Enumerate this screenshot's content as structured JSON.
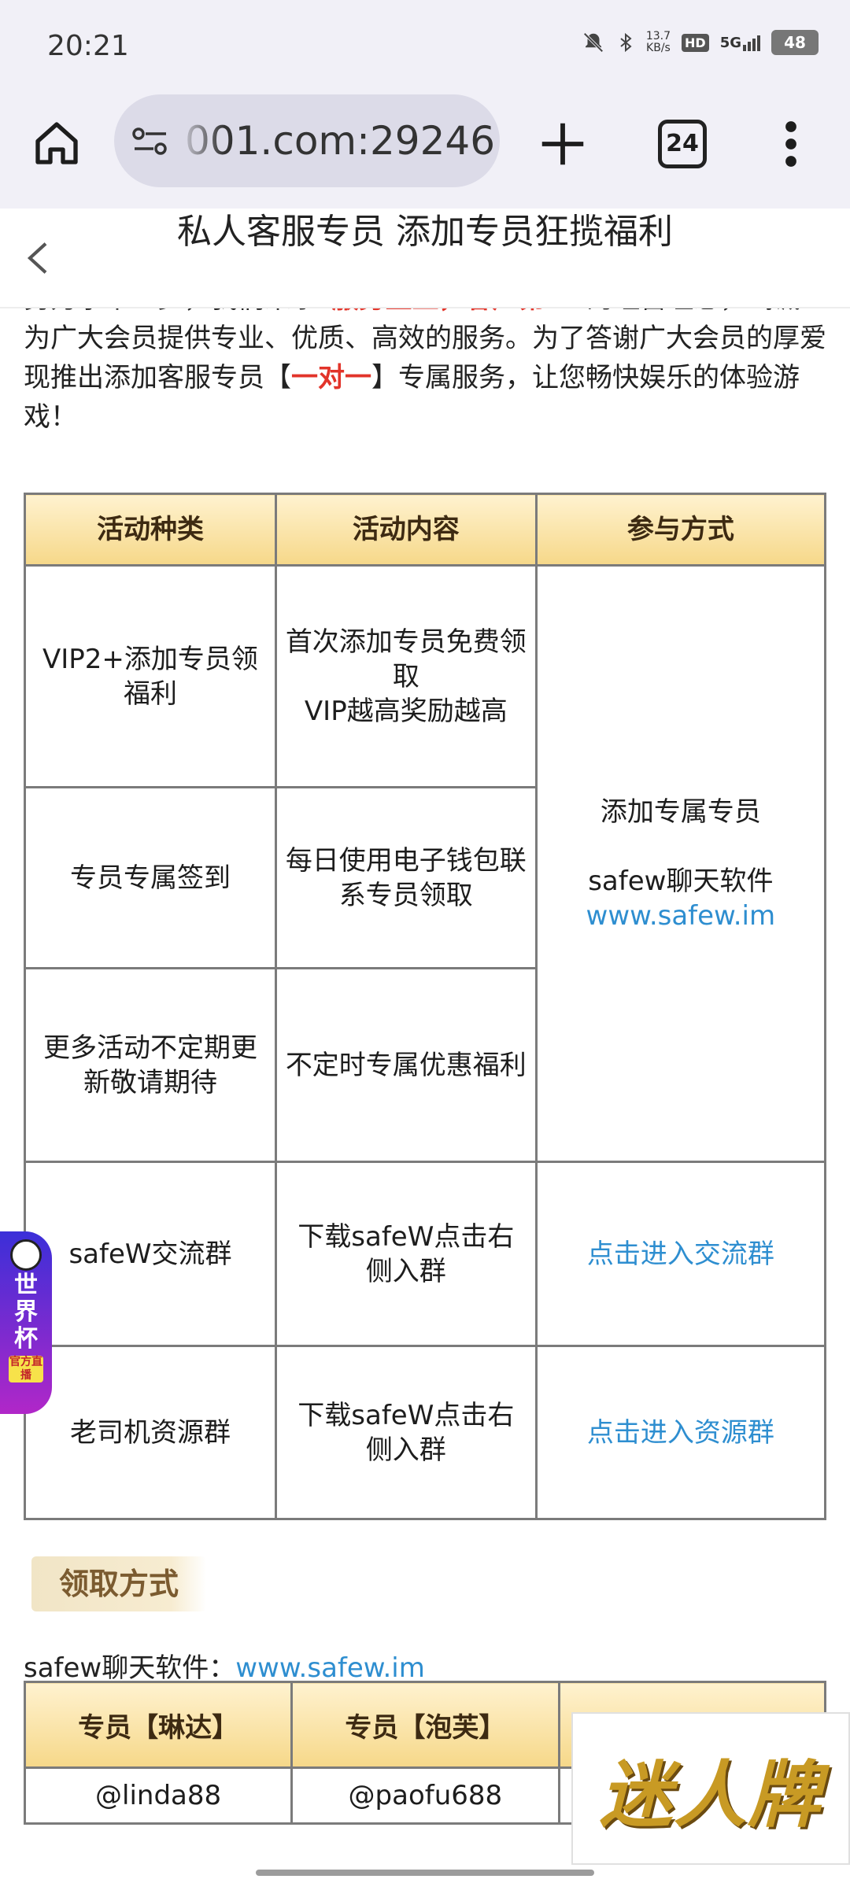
{
  "status_bar": {
    "time": "20:21",
    "net_speed_value": "13.7",
    "net_speed_unit": "KB/s",
    "hd_label": "HD",
    "signal_label": "5G",
    "battery": "48",
    "icons": [
      "mute-bell-icon",
      "bluetooth-icon",
      "signal-icon",
      "battery-icon"
    ]
  },
  "browser": {
    "url": "001.com:29246",
    "tab_count": "24",
    "icons": [
      "home-icon",
      "site-controls-icon",
      "plus-icon",
      "tabs-icon",
      "more-vert-icon"
    ]
  },
  "header": {
    "title": "私人客服专员 添加专员狂揽福利"
  },
  "intro": {
    "line1_prefix": "努力永不止步，我们秉承“",
    "line1_red": "服务至上，客户第一",
    "line1_suffix": "”的经营理念，竭诚为广大会员提供专业、优质、高效的服务。为了答谢广大会员的厚爱现推出添加客服专员【",
    "highlight": "一对一",
    "line_end": "】专属服务，让您畅快娱乐的体验游戏！"
  },
  "activity_table": {
    "headers": [
      "活动种类",
      "活动内容",
      "参与方式"
    ],
    "rows": [
      {
        "type": "VIP2+添加专员领福利",
        "content_line1": "首次添加专员免费领取",
        "content_line2": "VIP越高奖励越高"
      },
      {
        "type": "专员专属签到",
        "content_line1": "每日使用电子钱包联系专员领取"
      },
      {
        "type": "更多活动不定期更新敬请期待",
        "content_line1": "不定时专属优惠福利"
      },
      {
        "type": "safeW交流群",
        "content_line1": "下载safeW点击右侧入群",
        "join": "点击进入交流群"
      },
      {
        "type": "老司机资源群",
        "content_line1": "下载safeW点击右侧入群",
        "join": "点击进入资源群"
      }
    ],
    "merged_join": {
      "line1": "添加专属专员",
      "line2": "safew聊天软件",
      "link": "www.safew.im"
    }
  },
  "claim_section": {
    "title": "领取方式",
    "chat_label": "safew聊天软件：",
    "chat_link": "www.safew.im",
    "table_headers": [
      "专员【琳达】",
      "专员【泡芙】"
    ],
    "table_values": [
      "@linda88",
      "@paofu688"
    ]
  },
  "overlays": {
    "worldcup_title": "世界杯",
    "worldcup_sub": "官方直播",
    "logo_text": "迷人牌"
  },
  "colors": {
    "highlight_red": "#e2342a",
    "link_blue": "#2e8ed0",
    "header_gold": "#f6d889"
  }
}
